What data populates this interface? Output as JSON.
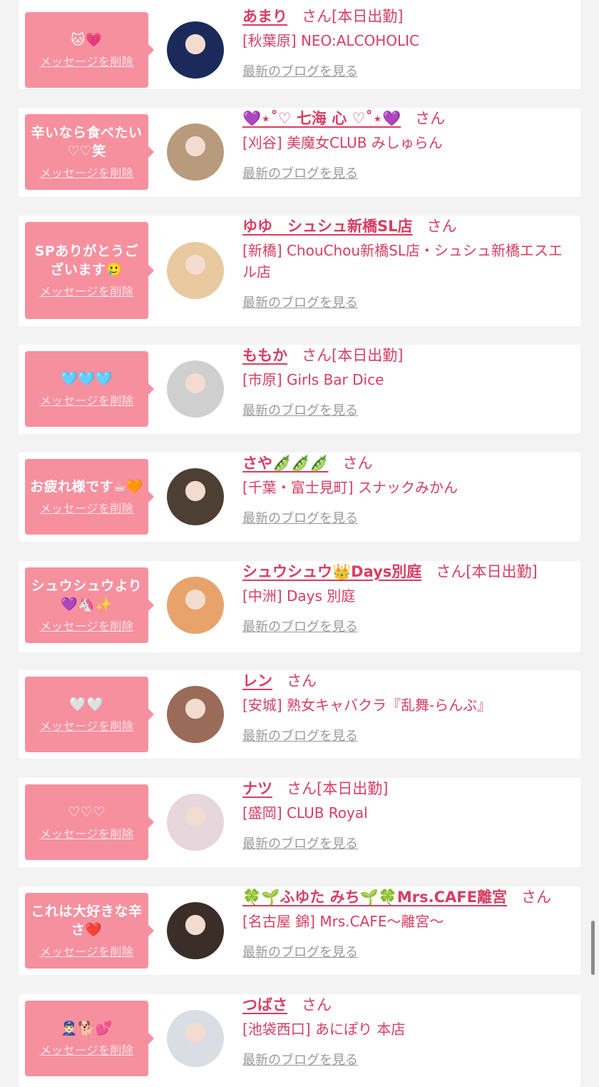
{
  "delete_label": "メッセージを削除",
  "blog_label": "最新のブログを見る",
  "san_label": "さん",
  "shift_label": "[本日出勤]",
  "cards": [
    {
      "message": "🐱💗",
      "name": "あまり",
      "working": true,
      "shop": "[秋葉原] NEO:ALCOHOLIC"
    },
    {
      "message": "辛いなら食べたい♡♡笑",
      "name": "💜⋆˚♡ 七海 心 ♡˚⋆💜",
      "working": false,
      "shop": "[刈谷] 美魔女CLUB みしゅらん"
    },
    {
      "message": "SPありがとうございます🥲",
      "name": "ゆゆ　シュシュ新橋SL店",
      "working": false,
      "shop": "[新橋] ChouChou新橋SL店・シュシュ新橋エスエル店"
    },
    {
      "message": "🩵🩵🩵",
      "name": "ももか",
      "working": true,
      "shop": "[市原] Girls Bar Dice"
    },
    {
      "message": "お疲れ様です☕🧡",
      "name": "さや🫛🫛🫛",
      "working": false,
      "shop": "[千葉・富士見町] スナックみかん"
    },
    {
      "message": "シュウシュウより💜🦄✨",
      "name": "シュウシュウ👑Days別庭",
      "working": true,
      "shop": "[中洲] Days 別庭"
    },
    {
      "message": "🤍🤍",
      "name": "レン",
      "working": false,
      "shop": "[安城] 熟女キャバクラ『乱舞-らんぶ』"
    },
    {
      "message": "♡♡♡",
      "name": "ナツ",
      "working": true,
      "shop": "[盛岡] CLUB Royal"
    },
    {
      "message": "これは大好きな辛さ❤️",
      "name": "🍀🌱ふゆた みち🌱🍀Mrs.CAFE離宮",
      "working": false,
      "shop": "[名古屋 錦] Mrs.CAFE〜離宮〜"
    },
    {
      "message": "👮🏻‍♂️🐕💕",
      "name": "つばさ",
      "working": false,
      "shop": "[池袋西口] あにぽり 本店"
    }
  ],
  "avatar_colors": [
    "#1b2a5a",
    "#b89a7c",
    "#e8c9a0",
    "#cfcfcf",
    "#4d3f33",
    "#e8a36b",
    "#9a6b58",
    "#e7d6dc",
    "#3b2d28",
    "#d9dde4"
  ]
}
